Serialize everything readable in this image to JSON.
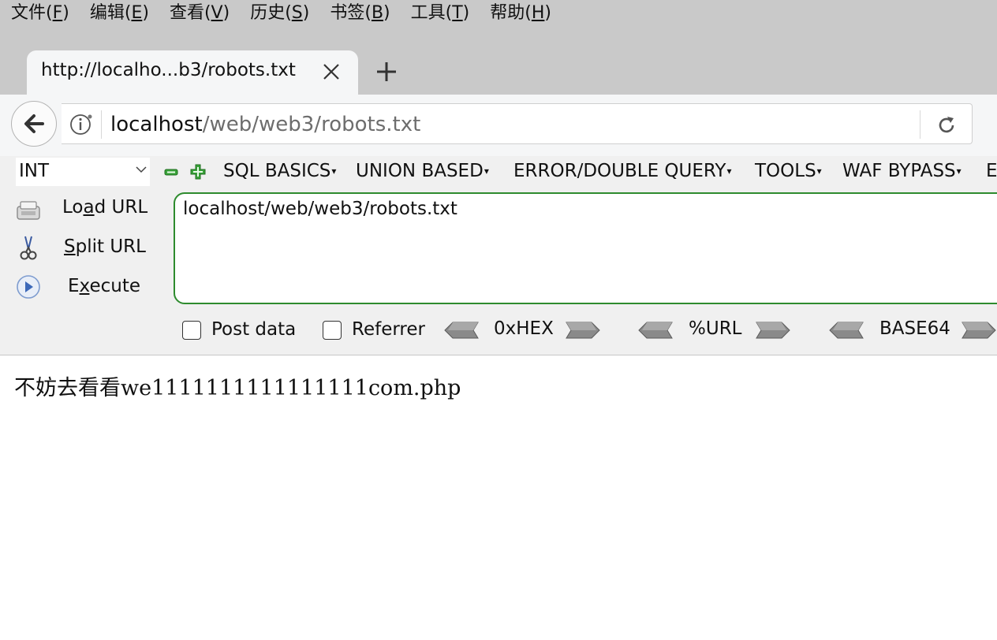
{
  "menubar": {
    "items": [
      {
        "label": "文件(",
        "key": "F",
        "suffix": ")"
      },
      {
        "label": "编辑(",
        "key": "E",
        "suffix": ")"
      },
      {
        "label": "查看(",
        "key": "V",
        "suffix": ")"
      },
      {
        "label": "历史(",
        "key": "S",
        "suffix": ")"
      },
      {
        "label": "书签(",
        "key": "B",
        "suffix": ")"
      },
      {
        "label": "工具(",
        "key": "T",
        "suffix": ")"
      },
      {
        "label": "帮助(",
        "key": "H",
        "suffix": ")"
      }
    ]
  },
  "tab": {
    "title": "http://localho...b3/robots.txt",
    "close_glyph": "✕",
    "new_tab_glyph": "+"
  },
  "navbar": {
    "url_host": "localhost",
    "url_path": "/web/web3/robots.txt"
  },
  "hackbar": {
    "select_value": "INT",
    "menus": [
      "SQL BASICS",
      "UNION BASED",
      "ERROR/DOUBLE QUERY",
      "TOOLS",
      "WAF BYPASS",
      "E"
    ],
    "load_url": {
      "pre": "Lo",
      "key": "a",
      "post": "d URL"
    },
    "split_url": {
      "pre": "",
      "key": "S",
      "post": "plit URL"
    },
    "execute": {
      "pre": "E",
      "key": "x",
      "post": "ecute"
    },
    "textarea_value": "localhost/web/web3/robots.txt",
    "post_data_label": "Post data",
    "referrer_label": "Referrer",
    "post_data_checked": false,
    "referrer_checked": false,
    "encoders": [
      "0xHEX",
      "%URL",
      "BASE64"
    ]
  },
  "page": {
    "text": "不妨去看看we1111111111111111com.php"
  },
  "colors": {
    "textarea_border": "#2e8b2e",
    "chrome_bg": "#c9c9c9",
    "toolbar_bg": "#f5f6f7"
  }
}
